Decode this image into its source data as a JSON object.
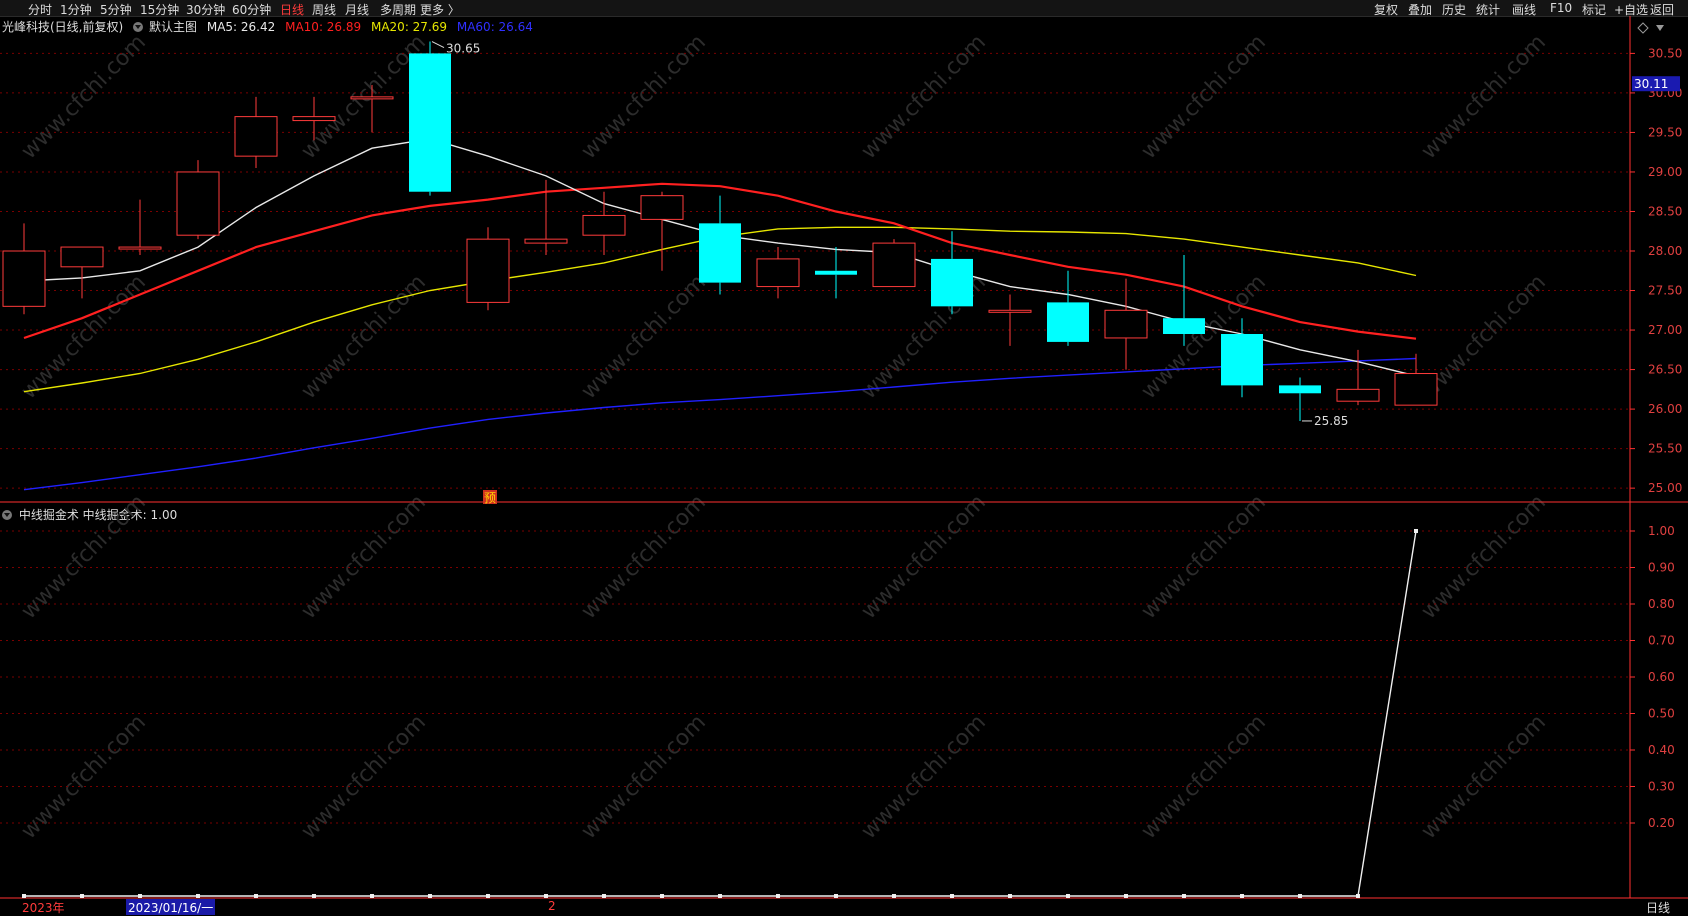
{
  "toolbar": {
    "periods": [
      "分时",
      "1分钟",
      "5分钟",
      "15分钟",
      "30分钟",
      "60分钟",
      "日线",
      "周线",
      "月线",
      "多周期",
      "更多 〉"
    ],
    "active_period": "日线",
    "right_buttons": [
      "复权",
      "叠加",
      "历史",
      "统计",
      "画线",
      "F10",
      "标记",
      "+自选",
      "返回"
    ]
  },
  "legend": {
    "stock": "光峰科技(日线,前复权)",
    "template": "默认主图",
    "ma5": "MA5: 26.42",
    "ma10": "MA10: 26.89",
    "ma20": "MA20: 27.69",
    "ma60": "MA60: 26.64"
  },
  "colors": {
    "up": "#ff3b3b",
    "down": "#00ffff",
    "ma5": "#e8e8e8",
    "ma10": "#ff2020",
    "ma20": "#e6e600",
    "ma60": "#2020ff",
    "grid": "#7a0000",
    "axis": "#ff3030"
  },
  "price_axis": [
    "30.50",
    "30.00",
    "29.50",
    "29.00",
    "28.50",
    "28.00",
    "27.50",
    "27.00",
    "26.50",
    "26.00",
    "25.50",
    "25.00"
  ],
  "price_tag": "30.11",
  "high_label": "30.65",
  "low_label": "25.85",
  "yu_marker": "预",
  "indicator": {
    "legend_name": "中线掘金术",
    "legend_value": "中线掘金术: 1.00",
    "axis": [
      "1.00",
      "0.90",
      "0.80",
      "0.70",
      "0.60",
      "0.50",
      "0.40",
      "0.30",
      "0.20"
    ]
  },
  "bottom": {
    "year": "2023年",
    "date": "2023/01/16/一",
    "mark": "2",
    "period_label": "日线"
  },
  "watermark": "www.cfchi.com",
  "chart_data": {
    "type": "candlestick",
    "ylim": [
      24.85,
      30.72
    ],
    "candles": [
      {
        "o": 27.3,
        "h": 28.35,
        "l": 27.2,
        "c": 28.0
      },
      {
        "o": 27.8,
        "h": 28.05,
        "l": 27.4,
        "c": 28.05
      },
      {
        "o": 28.05,
        "h": 28.65,
        "l": 27.95,
        "c": 28.05
      },
      {
        "o": 28.2,
        "h": 29.15,
        "l": 28.15,
        "c": 29.0
      },
      {
        "o": 29.2,
        "h": 29.95,
        "l": 29.05,
        "c": 29.7
      },
      {
        "o": 29.65,
        "h": 29.95,
        "l": 29.4,
        "c": 29.7
      },
      {
        "o": 29.95,
        "h": 30.1,
        "l": 29.5,
        "c": 29.95
      },
      {
        "o": 30.5,
        "h": 30.65,
        "l": 28.7,
        "c": 28.75
      },
      {
        "o": 27.35,
        "h": 28.3,
        "l": 27.25,
        "c": 28.15
      },
      {
        "o": 28.1,
        "h": 28.9,
        "l": 27.95,
        "c": 28.15
      },
      {
        "o": 28.2,
        "h": 28.75,
        "l": 27.95,
        "c": 28.45
      },
      {
        "o": 28.4,
        "h": 28.75,
        "l": 27.75,
        "c": 28.7
      },
      {
        "o": 28.35,
        "h": 28.7,
        "l": 27.45,
        "c": 27.6
      },
      {
        "o": 27.55,
        "h": 28.05,
        "l": 27.4,
        "c": 27.9
      },
      {
        "o": 27.75,
        "h": 28.05,
        "l": 27.4,
        "c": 27.7
      },
      {
        "o": 27.55,
        "h": 28.15,
        "l": 27.55,
        "c": 28.1
      },
      {
        "o": 27.9,
        "h": 28.25,
        "l": 27.2,
        "c": 27.3
      },
      {
        "o": 27.25,
        "h": 27.45,
        "l": 26.8,
        "c": 27.25
      },
      {
        "o": 27.35,
        "h": 27.75,
        "l": 26.8,
        "c": 26.85
      },
      {
        "o": 26.9,
        "h": 27.65,
        "l": 26.5,
        "c": 27.25
      },
      {
        "o": 27.15,
        "h": 27.95,
        "l": 26.8,
        "c": 26.95
      },
      {
        "o": 26.95,
        "h": 27.15,
        "l": 26.15,
        "c": 26.3
      },
      {
        "o": 26.3,
        "h": 26.4,
        "l": 25.85,
        "c": 26.2
      },
      {
        "o": 26.1,
        "h": 26.75,
        "l": 26.05,
        "c": 26.25
      },
      {
        "o": 26.05,
        "h": 26.7,
        "l": 26.05,
        "c": 26.45
      }
    ],
    "ma5": [
      27.62,
      27.66,
      27.75,
      28.05,
      28.55,
      28.95,
      29.3,
      29.42,
      29.2,
      28.95,
      28.6,
      28.4,
      28.2,
      28.1,
      28.02,
      27.98,
      27.75,
      27.55,
      27.45,
      27.3,
      27.1,
      26.95,
      26.75,
      26.6,
      26.42
    ],
    "ma10": [
      26.9,
      27.15,
      27.45,
      27.75,
      28.05,
      28.25,
      28.45,
      28.57,
      28.65,
      28.75,
      28.8,
      28.85,
      28.82,
      28.7,
      28.5,
      28.35,
      28.1,
      27.95,
      27.8,
      27.7,
      27.55,
      27.3,
      27.1,
      26.98,
      26.89
    ],
    "ma20": [
      26.22,
      26.33,
      26.45,
      26.63,
      26.85,
      27.1,
      27.32,
      27.5,
      27.62,
      27.73,
      27.85,
      28.02,
      28.18,
      28.28,
      28.3,
      28.3,
      28.28,
      28.25,
      28.24,
      28.22,
      28.15,
      28.05,
      27.95,
      27.85,
      27.69
    ],
    "ma60": [
      24.98,
      25.07,
      25.17,
      25.27,
      25.38,
      25.51,
      25.63,
      25.76,
      25.87,
      25.95,
      26.02,
      26.08,
      26.12,
      26.17,
      26.22,
      26.28,
      26.34,
      26.39,
      26.43,
      26.47,
      26.51,
      26.55,
      26.58,
      26.61,
      26.64
    ],
    "indicator_values": [
      0,
      0,
      0,
      0,
      0,
      0,
      0,
      0,
      0,
      0,
      0,
      0,
      0,
      0,
      0,
      0,
      0,
      0,
      0,
      0,
      0,
      0,
      0,
      0,
      1
    ],
    "indicator_ylim": [
      0,
      1
    ]
  }
}
